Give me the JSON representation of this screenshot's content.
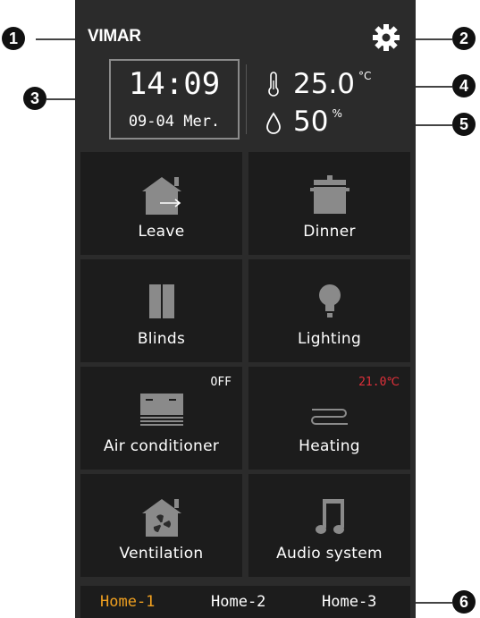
{
  "brand": "VIMAR",
  "clock": {
    "time": "14:09",
    "date": "09-04 Mer."
  },
  "environment": {
    "temperature": {
      "value": "25.0",
      "unit": "°C"
    },
    "humidity": {
      "value": "50",
      "unit": "%"
    }
  },
  "tiles": [
    {
      "label": "Leave",
      "icon": "leave-home-icon"
    },
    {
      "label": "Dinner",
      "icon": "cooking-pot-icon"
    },
    {
      "label": "Blinds",
      "icon": "blinds-icon"
    },
    {
      "label": "Lighting",
      "icon": "light-bulb-icon"
    },
    {
      "label": "Air conditioner",
      "icon": "air-conditioner-icon",
      "status": "OFF"
    },
    {
      "label": "Heating",
      "icon": "heating-icon",
      "status": "21.0℃"
    },
    {
      "label": "Ventilation",
      "icon": "fan-home-icon"
    },
    {
      "label": "Audio system",
      "icon": "music-note-icon"
    }
  ],
  "tabs": [
    {
      "label": "Home-1",
      "active": true
    },
    {
      "label": "Home-2",
      "active": false
    },
    {
      "label": "Home-3",
      "active": false
    }
  ],
  "callouts": [
    "1",
    "2",
    "3",
    "4",
    "5",
    "6"
  ],
  "colors": {
    "active_tab": "#f0a020",
    "heating_status": "#e0303a",
    "tile_bg": "#1c1c1c",
    "screen_bg": "#2b2b2b"
  }
}
